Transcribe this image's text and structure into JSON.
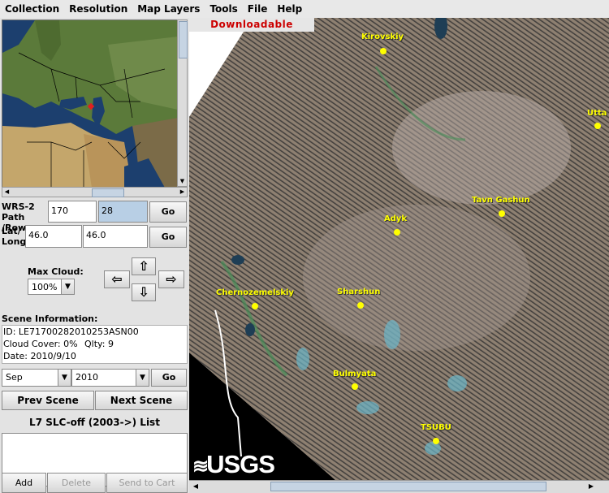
{
  "menu": [
    "Collection",
    "Resolution",
    "Map Layers",
    "Tools",
    "File",
    "Help"
  ],
  "nav": {
    "wrs_label": "WRS-2 Path /Row:",
    "path": "170",
    "row": "28",
    "latlong_label": "Lat/ Long:",
    "lat": "46.0",
    "long": "46.0",
    "go": "Go"
  },
  "cloud": {
    "label": "Max Cloud:",
    "value": "100%"
  },
  "scene": {
    "header": "Scene Information:",
    "id": "ID: LE71700282010253ASN00",
    "cover": "Cloud Cover: 0%",
    "quality": "Qlty: 9",
    "date": "Date: 2010/9/10"
  },
  "date_select": {
    "month": "Sep",
    "year": "2010",
    "go": "Go"
  },
  "scene_nav": {
    "prev": "Prev Scene",
    "next": "Next Scene"
  },
  "list_title": "L7 SLC-off (2003->) List",
  "actions": {
    "add": "Add",
    "delete": "Delete",
    "send": "Send to Cart"
  },
  "map": {
    "banner": "Downloadable",
    "logo": "USGS",
    "cities": [
      "Kirovskiy",
      "Utta",
      "Tavn Gashun",
      "Adyk",
      "Chernozemelskiy",
      "Sharshun",
      "Bulmyata",
      "TSUBU"
    ]
  },
  "colors": {
    "banner_text": "#cc0000",
    "city": "#ffff00",
    "scene_bg": "#8b7b6b"
  }
}
